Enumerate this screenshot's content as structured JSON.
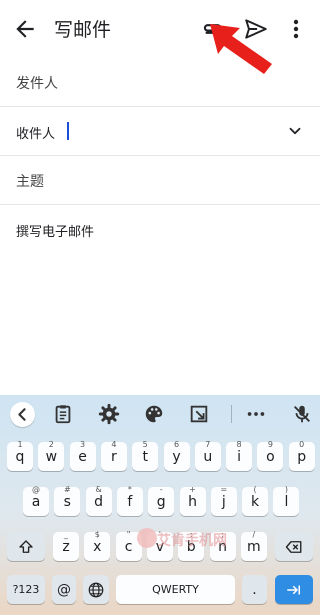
{
  "header": {
    "title": "写邮件"
  },
  "form": {
    "from_label": "发件人",
    "to_label": "收件人",
    "subject_placeholder": "主题",
    "body_placeholder": "撰写电子邮件"
  },
  "keyboard": {
    "row1": [
      {
        "key": "q",
        "hint": "1"
      },
      {
        "key": "w",
        "hint": "2"
      },
      {
        "key": "e",
        "hint": "3"
      },
      {
        "key": "r",
        "hint": "4"
      },
      {
        "key": "t",
        "hint": "5"
      },
      {
        "key": "y",
        "hint": "6"
      },
      {
        "key": "u",
        "hint": "7"
      },
      {
        "key": "i",
        "hint": "8"
      },
      {
        "key": "o",
        "hint": "9"
      },
      {
        "key": "p",
        "hint": "0"
      }
    ],
    "row2": [
      {
        "key": "a",
        "hint": "@"
      },
      {
        "key": "s",
        "hint": "#"
      },
      {
        "key": "d",
        "hint": "&"
      },
      {
        "key": "f",
        "hint": "*"
      },
      {
        "key": "g",
        "hint": "-"
      },
      {
        "key": "h",
        "hint": "+"
      },
      {
        "key": "j",
        "hint": "="
      },
      {
        "key": "k",
        "hint": "("
      },
      {
        "key": "l",
        "hint": ")"
      }
    ],
    "row3": [
      {
        "key": "z",
        "hint": "_"
      },
      {
        "key": "x",
        "hint": "$"
      },
      {
        "key": "c",
        "hint": "\""
      },
      {
        "key": "v",
        "hint": "'"
      },
      {
        "key": "b",
        "hint": ":"
      },
      {
        "key": "n",
        "hint": ";"
      },
      {
        "key": "m",
        "hint": "/"
      }
    ],
    "num_key": "?123",
    "at_key": "@",
    "space_label": "QWERTY",
    "period_key": "."
  },
  "watermark": "艾肯手机网",
  "colors": {
    "accent_arrow": "#e8201c",
    "enter": "#2f8de4",
    "cursor": "#1a4fd6"
  }
}
